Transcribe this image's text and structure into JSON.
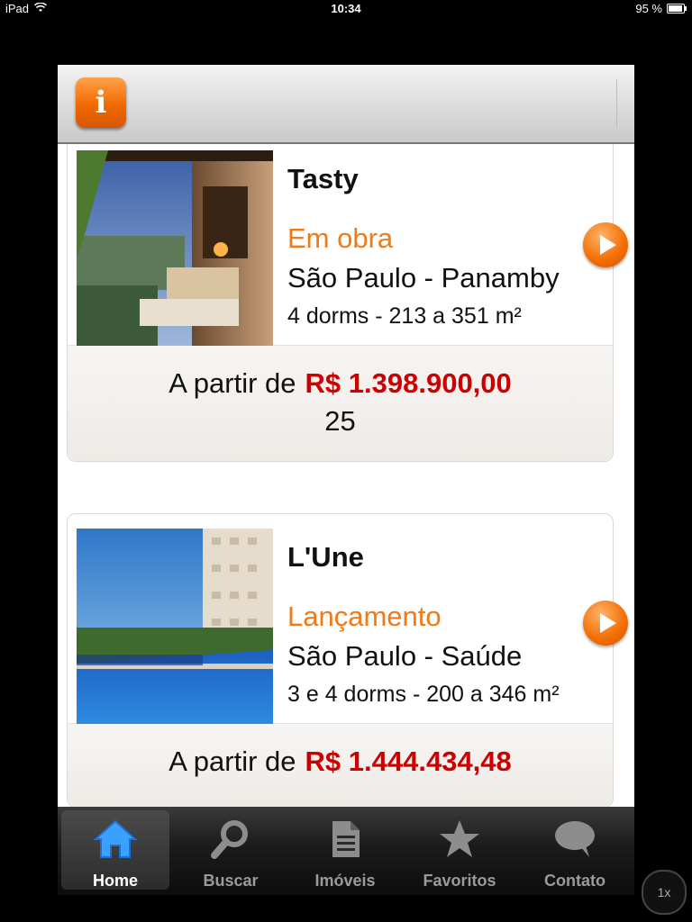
{
  "status_bar": {
    "device": "iPad",
    "time": "10:34",
    "battery": "95 %",
    "battery_level": 0.95
  },
  "header": {
    "info_label": "i"
  },
  "listings": [
    {
      "name": "Tasty",
      "status": "Em obra",
      "location": "São Paulo - Panamby",
      "details": "4 dorms - 213 a 351 m²",
      "price_prefix": "A partir de",
      "price": "R$ 1.398.900,00",
      "price_sub": "25"
    },
    {
      "name": "L'Une",
      "status": "Lançamento",
      "location": "São Paulo - Saúde",
      "details": "3 e 4 dorms - 200 a 346 m²",
      "price_prefix": "A partir de",
      "price": "R$ 1.444.434,48",
      "price_sub": ""
    }
  ],
  "tabbar": {
    "items": [
      {
        "label": "Home",
        "icon": "home-icon",
        "active": true
      },
      {
        "label": "Buscar",
        "icon": "search-icon"
      },
      {
        "label": "Imóveis",
        "icon": "document-icon"
      },
      {
        "label": "Favoritos",
        "icon": "star-icon"
      },
      {
        "label": "Contato",
        "icon": "speech-bubble-icon"
      }
    ]
  },
  "zoom": {
    "label": "1x"
  },
  "colors": {
    "accent_orange": "#f07a1a",
    "price_red": "#cc0000"
  }
}
